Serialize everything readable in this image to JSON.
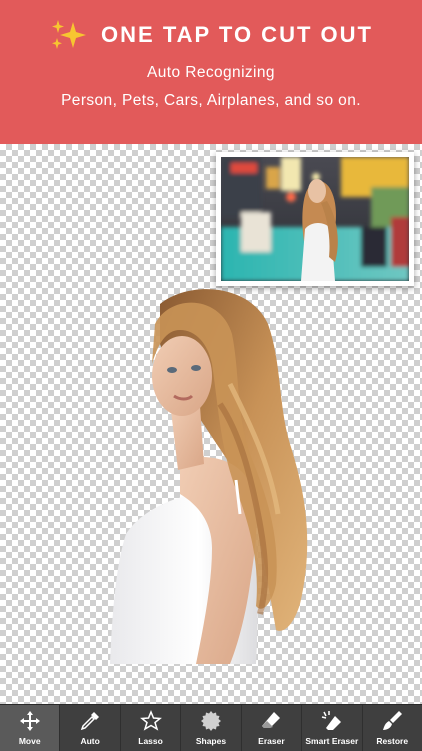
{
  "banner": {
    "headline": "ONE TAP TO CUT OUT",
    "subtitle_line1": "Auto Recognizing",
    "subtitle_line2": "Person, Pets, Cars, Airplanes, and so on.",
    "background_color": "#e25a5a",
    "icon": "sparkles-icon"
  },
  "toolbar": {
    "active_tool": "Move",
    "tools": [
      {
        "label": "Move",
        "icon": "move-icon"
      },
      {
        "label": "Auto",
        "icon": "auto-dropper-icon"
      },
      {
        "label": "Lasso",
        "icon": "lasso-icon"
      },
      {
        "label": "Shapes",
        "icon": "shapes-icon"
      },
      {
        "label": "Eraser",
        "icon": "eraser-icon"
      },
      {
        "label": "Smart Eraser",
        "icon": "smart-eraser-icon"
      },
      {
        "label": "Restore",
        "icon": "restore-brush-icon"
      }
    ]
  }
}
